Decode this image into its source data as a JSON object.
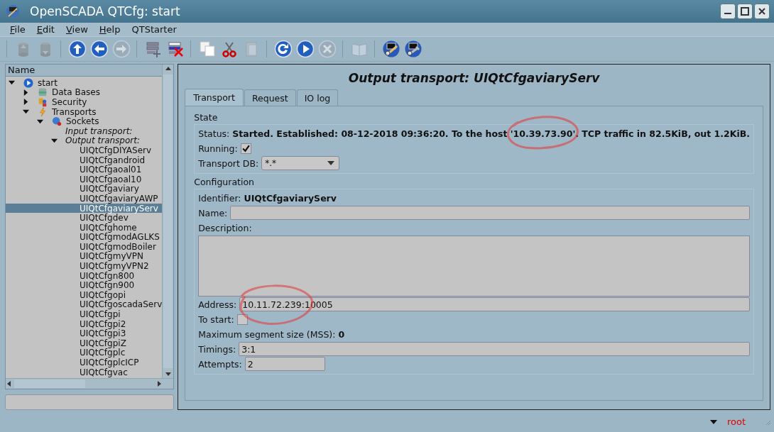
{
  "window": {
    "title": "OpenSCADA QTCfg: start"
  },
  "menu": [
    {
      "label": "File",
      "underline": true
    },
    {
      "label": "Edit",
      "underline": true
    },
    {
      "label": "View",
      "underline": true
    },
    {
      "label": "Help",
      "underline": true
    },
    {
      "label": "QTStarter",
      "underline": false
    }
  ],
  "toolbar": [
    [
      {
        "kind": "db-load",
        "disabled": true
      },
      {
        "kind": "db-save",
        "disabled": true
      }
    ],
    [
      {
        "kind": "up",
        "disabled": false
      },
      {
        "kind": "back",
        "disabled": false
      },
      {
        "kind": "forward",
        "disabled": true
      }
    ],
    [
      {
        "kind": "add",
        "disabled": false
      },
      {
        "kind": "delete",
        "disabled": false
      }
    ],
    [
      {
        "kind": "copy",
        "disabled": false
      },
      {
        "kind": "cut",
        "disabled": false
      },
      {
        "kind": "paste",
        "disabled": true
      }
    ],
    [
      {
        "kind": "refresh",
        "disabled": false
      },
      {
        "kind": "start",
        "disabled": false
      },
      {
        "kind": "stop",
        "disabled": true
      }
    ],
    [
      {
        "kind": "manual",
        "disabled": true
      }
    ],
    [
      {
        "kind": "tool-a",
        "disabled": false
      },
      {
        "kind": "tool-b",
        "disabled": false
      }
    ]
  ],
  "tree": {
    "header": "Name",
    "nodes": [
      {
        "label": "start",
        "kind": "station",
        "expanded": true,
        "selected": false,
        "children": [
          {
            "label": "Data Bases",
            "kind": "database",
            "expanded": false,
            "selected": false
          },
          {
            "label": "Security",
            "kind": "security",
            "expanded": false,
            "selected": false
          },
          {
            "label": "Transports",
            "kind": "transport",
            "expanded": true,
            "selected": false,
            "children": [
              {
                "label": "Sockets",
                "kind": "module",
                "expanded": true,
                "selected": false,
                "children": [
                  {
                    "label": "Input transport:",
                    "kind": "group",
                    "selected": false
                  },
                  {
                    "label": "Output transport:",
                    "kind": "group",
                    "expanded": true,
                    "selected": false,
                    "children": [
                      {
                        "label": "UIQtCfgDIYAServ",
                        "selected": false
                      },
                      {
                        "label": "UIQtCfgandroid",
                        "selected": false
                      },
                      {
                        "label": "UIQtCfgaoal01",
                        "selected": false
                      },
                      {
                        "label": "UIQtCfgaoal10",
                        "selected": false
                      },
                      {
                        "label": "UIQtCfgaviary",
                        "selected": false
                      },
                      {
                        "label": "UIQtCfgaviaryAWP",
                        "selected": false
                      },
                      {
                        "label": "UIQtCfgaviaryServ",
                        "selected": true
                      },
                      {
                        "label": "UIQtCfgdev",
                        "selected": false
                      },
                      {
                        "label": "UIQtCfghome",
                        "selected": false
                      },
                      {
                        "label": "UIQtCfgmodAGLKS",
                        "selected": false
                      },
                      {
                        "label": "UIQtCfgmodBoiler",
                        "selected": false
                      },
                      {
                        "label": "UIQtCfgmyVPN",
                        "selected": false
                      },
                      {
                        "label": "UIQtCfgmyVPN2",
                        "selected": false
                      },
                      {
                        "label": "UIQtCfgn800",
                        "selected": false
                      },
                      {
                        "label": "UIQtCfgn900",
                        "selected": false
                      },
                      {
                        "label": "UIQtCfgopi",
                        "selected": false
                      },
                      {
                        "label": "UIQtCfgoscadaServ",
                        "selected": false
                      },
                      {
                        "label": "UIQtCfgpi",
                        "selected": false
                      },
                      {
                        "label": "UIQtCfgpi2",
                        "selected": false
                      },
                      {
                        "label": "UIQtCfgpi3",
                        "selected": false
                      },
                      {
                        "label": "UIQtCfgpiZ",
                        "selected": false
                      },
                      {
                        "label": "UIQtCfgplc",
                        "selected": false
                      },
                      {
                        "label": "UIQtCfgplcICP",
                        "selected": false
                      },
                      {
                        "label": "UIQtCfgvac",
                        "selected": false
                      }
                    ]
                  }
                ]
              }
            ]
          }
        ]
      }
    ]
  },
  "page": {
    "title": "Output transport: UIQtCfgaviaryServ",
    "tabs": [
      {
        "label": "Transport",
        "selected": true
      },
      {
        "label": "Request",
        "selected": false
      },
      {
        "label": "IO log",
        "selected": false
      }
    ],
    "state": {
      "heading": "State",
      "status_label": "Status:",
      "status": "Started. Established: 08-12-2018 09:36:20. To the host '10.39.73.90'. TCP traffic in 82.5KiB, out 1.2KiB.",
      "running": {
        "label": "Running:",
        "checked": true
      },
      "transport_db": {
        "label": "Transport DB:",
        "value": "*.*"
      }
    },
    "configuration": {
      "heading": "Configuration",
      "identifier": {
        "label": "Identifier:",
        "value": "UIQtCfgaviaryServ"
      },
      "name": {
        "label": "Name:"
      },
      "description": {
        "label": "Description:"
      },
      "address": {
        "label": "Address:",
        "value": "10.11.72.239:10005"
      },
      "to_start": {
        "label": "To start:",
        "checked": false
      },
      "mss": {
        "label": "Maximum segment size (MSS):",
        "value": "0"
      },
      "timings": {
        "label": "Timings:",
        "value": "3:1"
      },
      "attempts": {
        "label": "Attempts:",
        "value": "2"
      }
    }
  },
  "status_bar": {
    "user": "root"
  }
}
